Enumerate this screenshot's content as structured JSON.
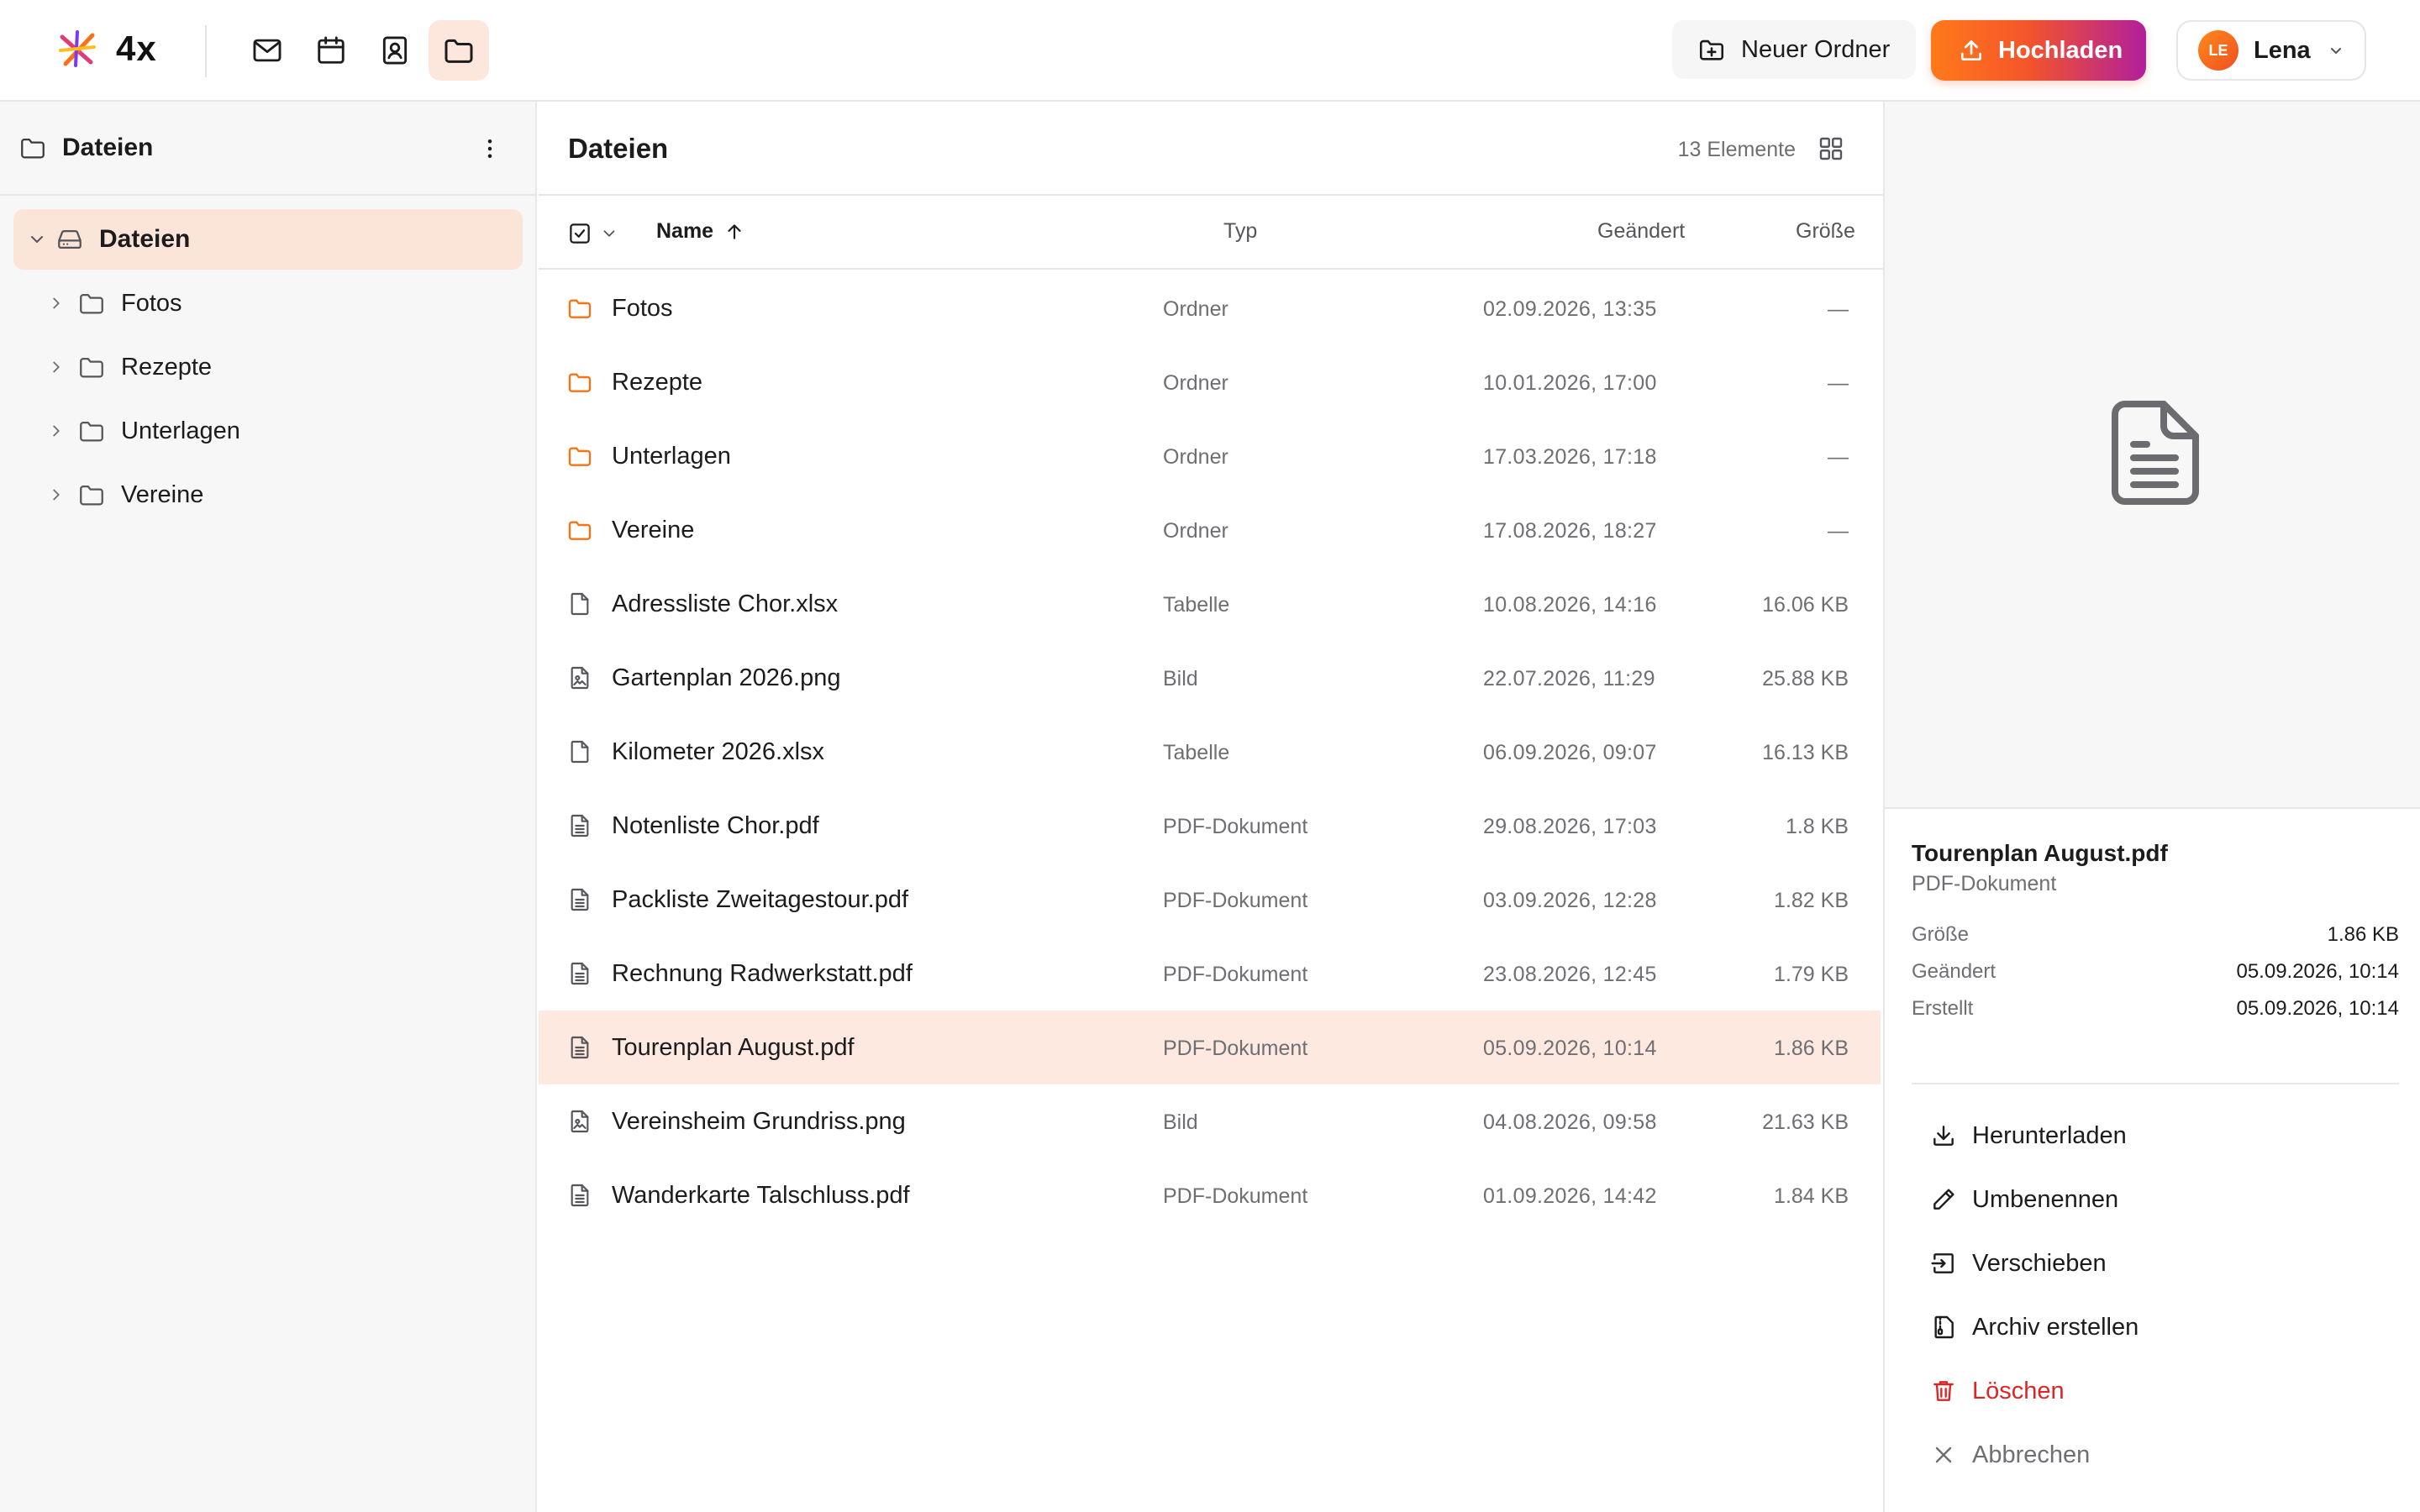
{
  "brand": {
    "name": "4x"
  },
  "apps": [
    {
      "name": "mail-icon",
      "active": false
    },
    {
      "name": "calendar-icon",
      "active": false
    },
    {
      "name": "contacts-icon",
      "active": false
    },
    {
      "name": "folder-icon",
      "active": true
    }
  ],
  "toolbar": {
    "new_folder_label": "Neuer Ordner",
    "upload_label": "Hochladen"
  },
  "user": {
    "initials": "LE",
    "name": "Lena"
  },
  "sidebar": {
    "title": "Dateien",
    "root": {
      "label": "Dateien"
    },
    "items": [
      {
        "label": "Fotos"
      },
      {
        "label": "Rezepte"
      },
      {
        "label": "Unterlagen"
      },
      {
        "label": "Vereine"
      }
    ]
  },
  "main": {
    "title": "Dateien",
    "count_label": "13 Elemente",
    "columns": {
      "name": "Name",
      "type": "Typ",
      "modified": "Geändert",
      "size": "Größe"
    },
    "rows": [
      {
        "name": "Fotos",
        "type": "Ordner",
        "modified": "02.09.2026, 13:35",
        "size": "—",
        "icon": "folder-icon"
      },
      {
        "name": "Rezepte",
        "type": "Ordner",
        "modified": "10.01.2026, 17:00",
        "size": "—",
        "icon": "folder-icon"
      },
      {
        "name": "Unterlagen",
        "type": "Ordner",
        "modified": "17.03.2026, 17:18",
        "size": "—",
        "icon": "folder-icon"
      },
      {
        "name": "Vereine",
        "type": "Ordner",
        "modified": "17.08.2026, 18:27",
        "size": "—",
        "icon": "folder-icon"
      },
      {
        "name": "Adressliste Chor.xlsx",
        "type": "Tabelle",
        "modified": "10.08.2026, 14:16",
        "size": "16.06 KB",
        "icon": "file-icon"
      },
      {
        "name": "Gartenplan 2026.png",
        "type": "Bild",
        "modified": "22.07.2026, 11:29",
        "size": "25.88 KB",
        "icon": "image-file-icon"
      },
      {
        "name": "Kilometer 2026.xlsx",
        "type": "Tabelle",
        "modified": "06.09.2026, 09:07",
        "size": "16.13 KB",
        "icon": "file-icon"
      },
      {
        "name": "Notenliste Chor.pdf",
        "type": "PDF-Dokument",
        "modified": "29.08.2026, 17:03",
        "size": "1.8 KB",
        "icon": "document-icon"
      },
      {
        "name": "Packliste Zweitagestour.pdf",
        "type": "PDF-Dokument",
        "modified": "03.09.2026, 12:28",
        "size": "1.82 KB",
        "icon": "document-icon"
      },
      {
        "name": "Rechnung Radwerkstatt.pdf",
        "type": "PDF-Dokument",
        "modified": "23.08.2026, 12:45",
        "size": "1.79 KB",
        "icon": "document-icon"
      },
      {
        "name": "Tourenplan August.pdf",
        "type": "PDF-Dokument",
        "modified": "05.09.2026, 10:14",
        "size": "1.86 KB",
        "icon": "document-icon",
        "selected": true
      },
      {
        "name": "Vereinsheim Grundriss.png",
        "type": "Bild",
        "modified": "04.08.2026, 09:58",
        "size": "21.63 KB",
        "icon": "image-file-icon"
      },
      {
        "name": "Wanderkarte Talschluss.pdf",
        "type": "PDF-Dokument",
        "modified": "01.09.2026, 14:42",
        "size": "1.84 KB",
        "icon": "document-icon"
      }
    ]
  },
  "detail": {
    "name": "Tourenplan August.pdf",
    "type": "PDF-Dokument",
    "meta": [
      {
        "key": "Größe",
        "value": "1.86 KB"
      },
      {
        "key": "Geändert",
        "value": "05.09.2026, 10:14"
      },
      {
        "key": "Erstellt",
        "value": "05.09.2026, 10:14"
      }
    ],
    "actions": {
      "download": "Herunterladen",
      "rename": "Umbenennen",
      "move": "Verschieben",
      "archive": "Archiv erstellen",
      "delete": "Löschen",
      "cancel": "Abbrechen"
    }
  },
  "colors": {
    "accent": "#f97316",
    "selected_row": "#fde9e0",
    "danger": "#dc2626",
    "folder": "#f97316"
  }
}
